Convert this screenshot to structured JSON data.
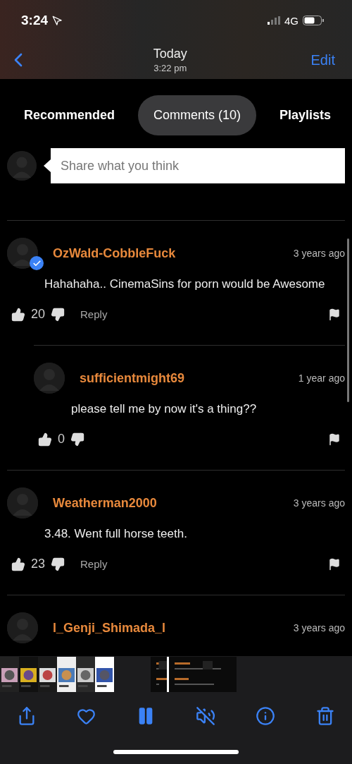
{
  "status_bar": {
    "time": "3:24",
    "network": "4G"
  },
  "nav": {
    "title": "Today",
    "subtitle": "3:22 pm",
    "edit": "Edit"
  },
  "tabs": [
    {
      "label": "Recommended",
      "selected": false
    },
    {
      "label": "Comments (10)",
      "selected": true
    },
    {
      "label": "Playlists",
      "selected": false
    }
  ],
  "comment_box": {
    "placeholder": "Share what you think"
  },
  "comments": [
    {
      "user": "OzWald-CobbleFuck",
      "time": "3 years ago",
      "verified": true,
      "is_reply": false,
      "text": "Hahahaha.. CinemaSins for porn would be Awesome",
      "likes": "20",
      "reply": "Reply"
    },
    {
      "user": "sufficientmight69",
      "time": "1 year ago",
      "verified": false,
      "is_reply": true,
      "text": "please tell me by now it's a thing??",
      "likes": "0"
    },
    {
      "user": "Weatherman2000",
      "time": "3 years ago",
      "verified": false,
      "is_reply": false,
      "text": "3.48. Went full horse teeth.",
      "likes": "23",
      "reply": "Reply"
    },
    {
      "user": "l_Genji_Shimada_l",
      "time": "3 years ago",
      "verified": false,
      "is_reply": false
    }
  ]
}
